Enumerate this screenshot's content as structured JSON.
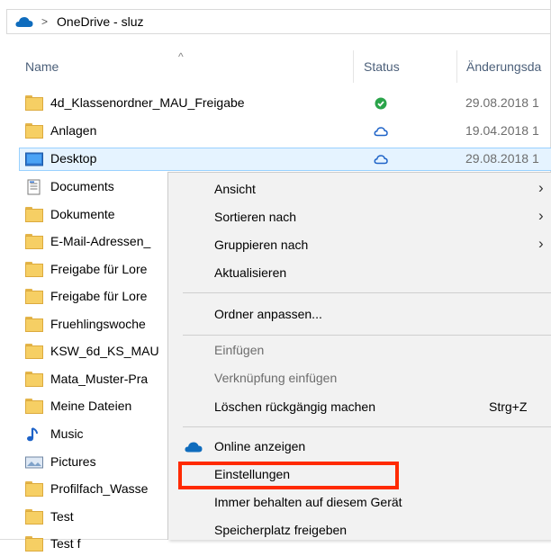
{
  "breadcrumb": {
    "location": "OneDrive - sluz"
  },
  "columns": {
    "name": "Name",
    "status": "Status",
    "date": "Änderungsda"
  },
  "rows": [
    {
      "name": "4d_Klassenordner_MAU_Freigabe",
      "icon": "folder-icon",
      "status": "synced",
      "date": "29.08.2018 1"
    },
    {
      "name": "Anlagen",
      "icon": "folder-icon",
      "status": "cloud",
      "date": "19.04.2018 1"
    },
    {
      "name": "Desktop",
      "icon": "desktop-folder-icon",
      "status": "cloud",
      "date": "29.08.2018 1"
    },
    {
      "name": "Documents",
      "icon": "documents-icon",
      "status": "",
      "date": ""
    },
    {
      "name": "Dokumente",
      "icon": "folder-icon",
      "status": "",
      "date": ""
    },
    {
      "name": "E-Mail-Adressen_",
      "icon": "folder-icon",
      "status": "",
      "date": ""
    },
    {
      "name": "Freigabe für Lore",
      "icon": "folder-icon",
      "status": "",
      "date": ""
    },
    {
      "name": "Freigabe für Lore",
      "icon": "folder-icon",
      "status": "",
      "date": ""
    },
    {
      "name": "Fruehlingswoche",
      "icon": "folder-icon",
      "status": "",
      "date": ""
    },
    {
      "name": "KSW_6d_KS_MAU",
      "icon": "folder-icon",
      "status": "",
      "date": ""
    },
    {
      "name": "Mata_Muster-Pra",
      "icon": "folder-icon",
      "status": "",
      "date": ""
    },
    {
      "name": "Meine Dateien",
      "icon": "folder-icon",
      "status": "",
      "date": ""
    },
    {
      "name": "Music",
      "icon": "music-icon",
      "status": "",
      "date": ""
    },
    {
      "name": "Pictures",
      "icon": "pictures-icon",
      "status": "",
      "date": ""
    },
    {
      "name": "Profilfach_Wasse",
      "icon": "folder-icon",
      "status": "",
      "date": ""
    },
    {
      "name": "Test",
      "icon": "folder-icon",
      "status": "",
      "date": ""
    },
    {
      "name": "Test f",
      "icon": "folder-icon",
      "status": "",
      "date": ""
    }
  ],
  "menu": {
    "ansicht": "Ansicht",
    "sortieren": "Sortieren nach",
    "gruppieren": "Gruppieren nach",
    "aktualisieren": "Aktualisieren",
    "ordner_anpassen": "Ordner anpassen...",
    "einfuegen": "Einfügen",
    "verknuepfung": "Verknüpfung einfügen",
    "loeschen": "Löschen rückgängig machen",
    "loeschen_shortcut": "Strg+Z",
    "online": "Online anzeigen",
    "einstellungen": "Einstellungen",
    "immer": "Immer behalten auf diesem Gerät",
    "speicher": "Speicherplatz freigeben"
  },
  "colors": {
    "accent": "#0078d7",
    "highlight": "#ff2a00",
    "folder": "#f6cf64"
  }
}
